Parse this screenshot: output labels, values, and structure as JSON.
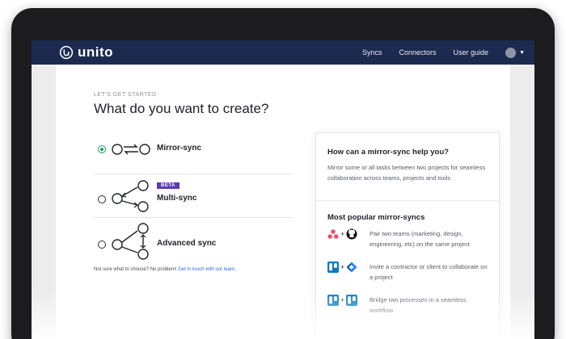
{
  "app": {
    "brand": "unito"
  },
  "nav": {
    "syncs": "Syncs",
    "connectors": "Connectors",
    "user_guide": "User guide"
  },
  "header": {
    "eyebrow": "LET'S GET STARTED",
    "title": "What do you want to create?"
  },
  "options": [
    {
      "label": "Mirror-sync",
      "selected": true
    },
    {
      "label": "Multi-sync",
      "badge": "BETA",
      "selected": false
    },
    {
      "label": "Advanced sync",
      "selected": false
    }
  ],
  "help": {
    "text": "Not sure what to choose? No problem!",
    "link": "Get in touch with our team."
  },
  "panel": {
    "heading": "How can a mirror-sync help you?",
    "description": "Mirror some or all tasks between two projects for seamless collaboration across teams, projects and tools",
    "popular_heading": "Most popular mirror-syncs",
    "items": [
      {
        "text": "Pair two teams (marketing, design, engineering, etc) on the same project",
        "icons": [
          "asana-icon",
          "github-icon"
        ]
      },
      {
        "text": "Invite a contractor or client to collaborate on a project",
        "icons": [
          "trello-icon",
          "jira-icon"
        ]
      },
      {
        "text": "Bridge two processes in a seamless workflow",
        "icons": [
          "trello-icon",
          "trello-icon"
        ]
      }
    ]
  },
  "colors": {
    "nav_bg": "#1b2a4e",
    "accent_green": "#1e9e5a",
    "beta_purple": "#5b3bb0",
    "link_blue": "#2a6ed6"
  }
}
